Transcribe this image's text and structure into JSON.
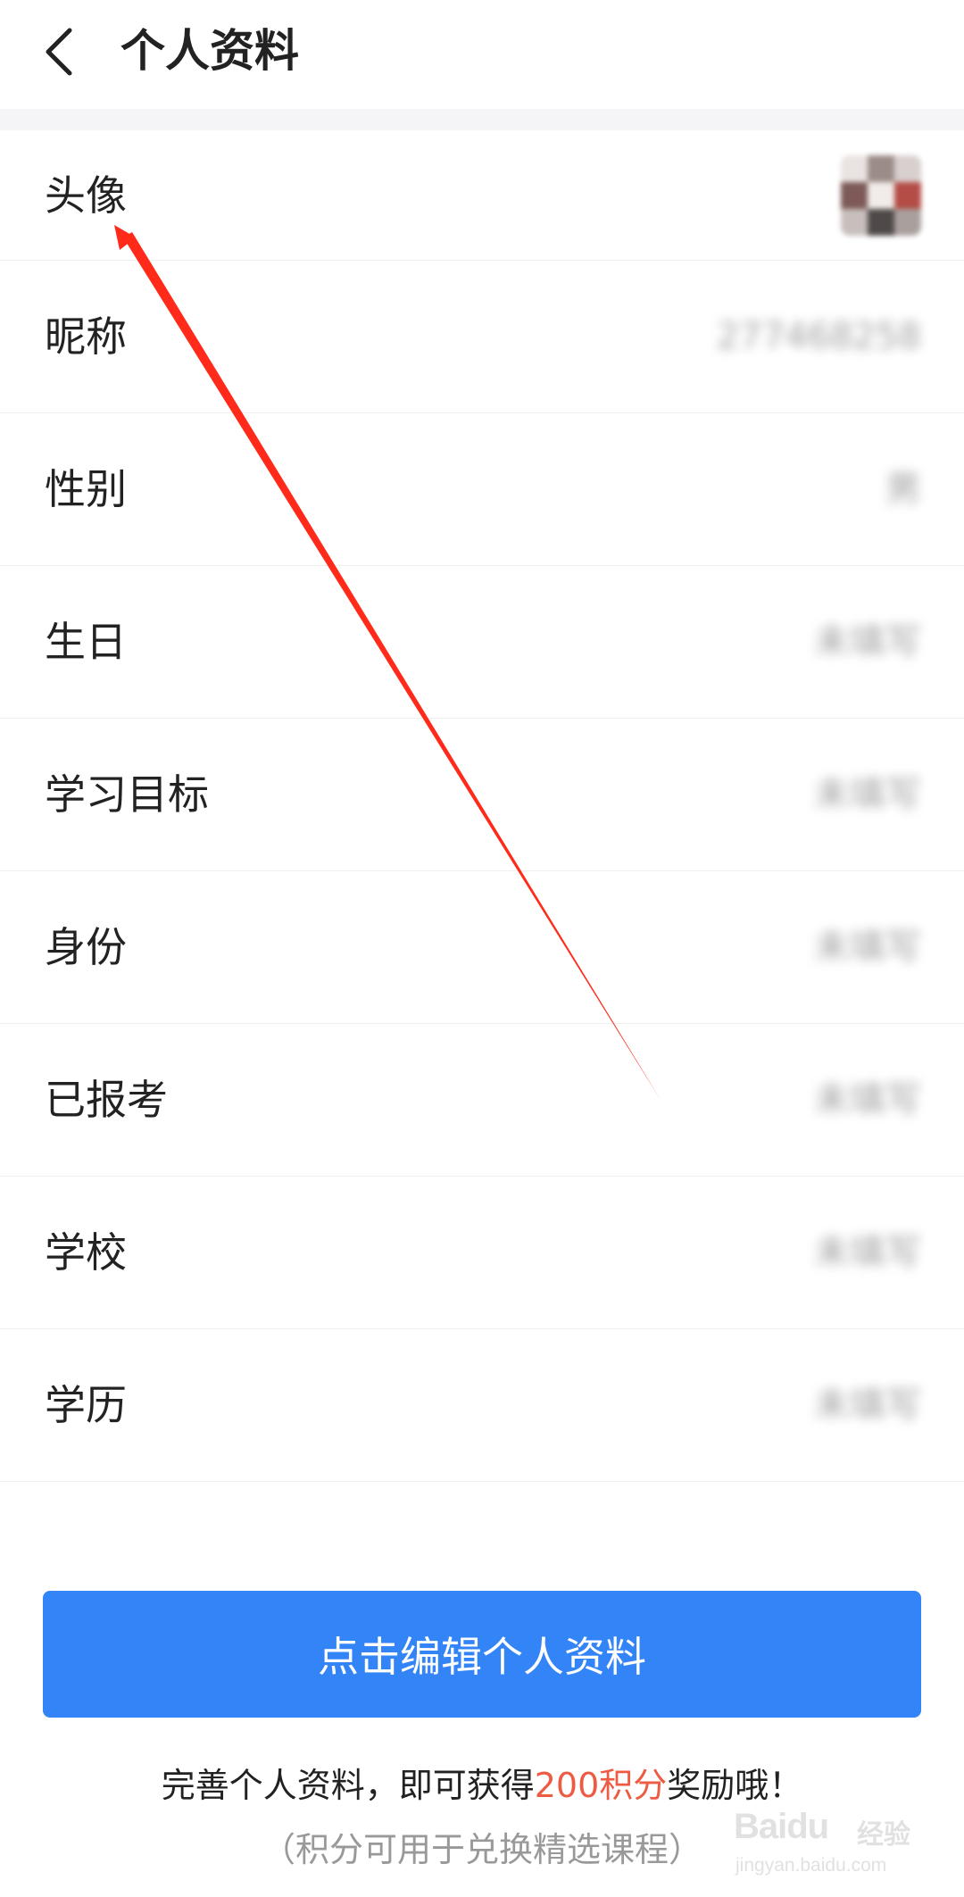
{
  "header": {
    "back_icon": "chevron-left-icon",
    "title": "个人资料"
  },
  "profile_rows": [
    {
      "key": "avatar",
      "label": "头像",
      "value": ""
    },
    {
      "key": "nickname",
      "label": "昵称",
      "value": "277468258"
    },
    {
      "key": "gender",
      "label": "性别",
      "value": "男"
    },
    {
      "key": "birthday",
      "label": "生日",
      "value": "未填写"
    },
    {
      "key": "study_goal",
      "label": "学习目标",
      "value": "未填写"
    },
    {
      "key": "identity",
      "label": "身份",
      "value": "未填写"
    },
    {
      "key": "registered_exam",
      "label": "已报考",
      "value": "未填写"
    },
    {
      "key": "school",
      "label": "学校",
      "value": "未填写"
    },
    {
      "key": "education",
      "label": "学历",
      "value": "未填写"
    }
  ],
  "edit_button": {
    "label": "点击编辑个人资料",
    "color": "#3384f7"
  },
  "reward": {
    "prefix": "完善个人资料，即可获得",
    "highlight": "200积分",
    "suffix": "奖励哦！",
    "highlight_color": "#ee5b43",
    "note": "（积分可用于兑换精选课程）"
  },
  "watermark": {
    "logo": "Baidu",
    "label": "经验",
    "url": "jingyan.baidu.com"
  },
  "annotation": {
    "type": "red-arrow",
    "points_to": "头像",
    "color": "#ff2a1a"
  }
}
